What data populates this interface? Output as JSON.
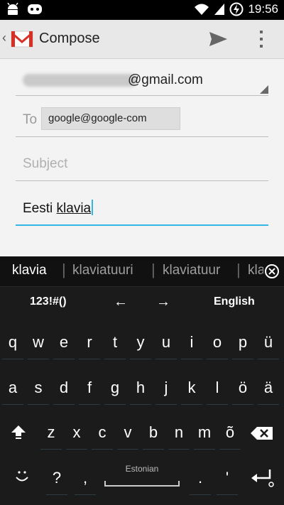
{
  "status_bar": {
    "time": "19:56",
    "icons": [
      "android-icon",
      "cyanogen-icon",
      "wifi-icon",
      "signal-icon",
      "battery-charging-icon"
    ]
  },
  "action_bar": {
    "title": "Compose",
    "icons": [
      "back-chevron-icon",
      "gmail-logo-icon",
      "send-icon",
      "overflow-menu-icon"
    ]
  },
  "compose": {
    "from_suffix": "@gmail.com",
    "to_label": "To",
    "to_chip": "google@google-com",
    "subject_placeholder": "Subject",
    "body_prefix": "Eesti ",
    "body_underlined": "klavia"
  },
  "keyboard": {
    "suggestions": [
      "klavia",
      "klaviatuuri",
      "klaviatuur",
      "klavia"
    ],
    "top_row": {
      "symbols": "123!#()",
      "left": "←",
      "right": "→",
      "language": "English"
    },
    "row1": [
      "q",
      "w",
      "e",
      "r",
      "t",
      "y",
      "u",
      "i",
      "o",
      "p",
      "ü"
    ],
    "row2": [
      "a",
      "s",
      "d",
      "f",
      "g",
      "h",
      "j",
      "k",
      "l",
      "ö",
      "ä"
    ],
    "row3": [
      "z",
      "x",
      "c",
      "v",
      "b",
      "n",
      "m",
      "õ"
    ],
    "row4": {
      "question": "?",
      "comma": ",",
      "space_label": "Estonian",
      "period": ".",
      "apostrophe": "'"
    },
    "accent_color": "#33b5e5"
  }
}
